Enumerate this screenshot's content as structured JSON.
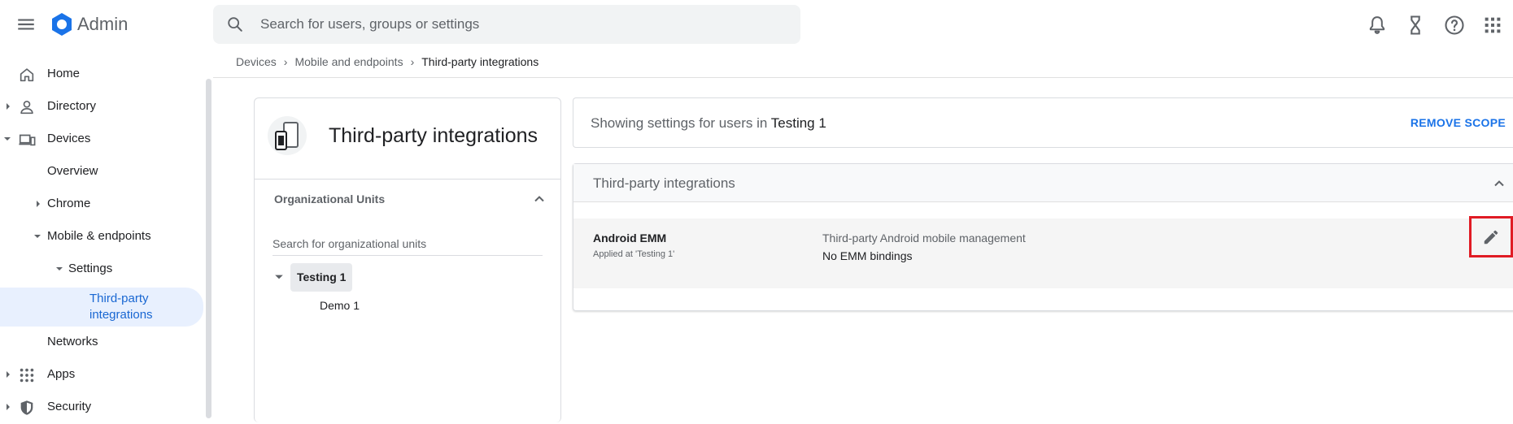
{
  "app": {
    "name": "Admin"
  },
  "search": {
    "placeholder": "Search for users, groups or settings"
  },
  "colors": {
    "accent": "#1a73e8",
    "active_bg": "#e8f0fe",
    "highlight_border": "#e01b24"
  },
  "icons": {
    "topbar": [
      "menu-icon",
      "admin-logo-icon",
      "search-icon",
      "bell-icon",
      "hourglass-icon",
      "help-icon",
      "apps-grid-icon"
    ]
  },
  "sidebar": {
    "items": [
      {
        "label": "Home",
        "icon": "home-icon"
      },
      {
        "label": "Directory",
        "icon": "person-icon"
      },
      {
        "label": "Devices",
        "icon": "devices-icon"
      },
      {
        "label": "Overview"
      },
      {
        "label": "Chrome"
      },
      {
        "label": "Mobile & endpoints"
      },
      {
        "label": "Settings"
      },
      {
        "label": "Third-party integrations"
      },
      {
        "label": "Networks"
      },
      {
        "label": "Apps",
        "icon": "apps-icon"
      },
      {
        "label": "Security",
        "icon": "shield-icon"
      }
    ]
  },
  "breadcrumb": {
    "items": [
      "Devices",
      "Mobile and endpoints",
      "Third-party integrations"
    ]
  },
  "left_card": {
    "title": "Third-party integrations",
    "ou_heading": "Organizational Units",
    "ou_search_placeholder": "Search for organizational units",
    "tree": [
      {
        "label": "Testing 1",
        "selected": true
      },
      {
        "label": "Demo 1",
        "selected": false
      }
    ]
  },
  "scope": {
    "prefix": "Showing settings for users in",
    "ou": "Testing 1",
    "remove_label": "REMOVE SCOPE"
  },
  "panel": {
    "title": "Third-party integrations",
    "settings": [
      {
        "name": "Android EMM",
        "applied": "Applied at 'Testing 1'",
        "description": "Third-party Android mobile management",
        "value": "No EMM bindings"
      }
    ]
  }
}
